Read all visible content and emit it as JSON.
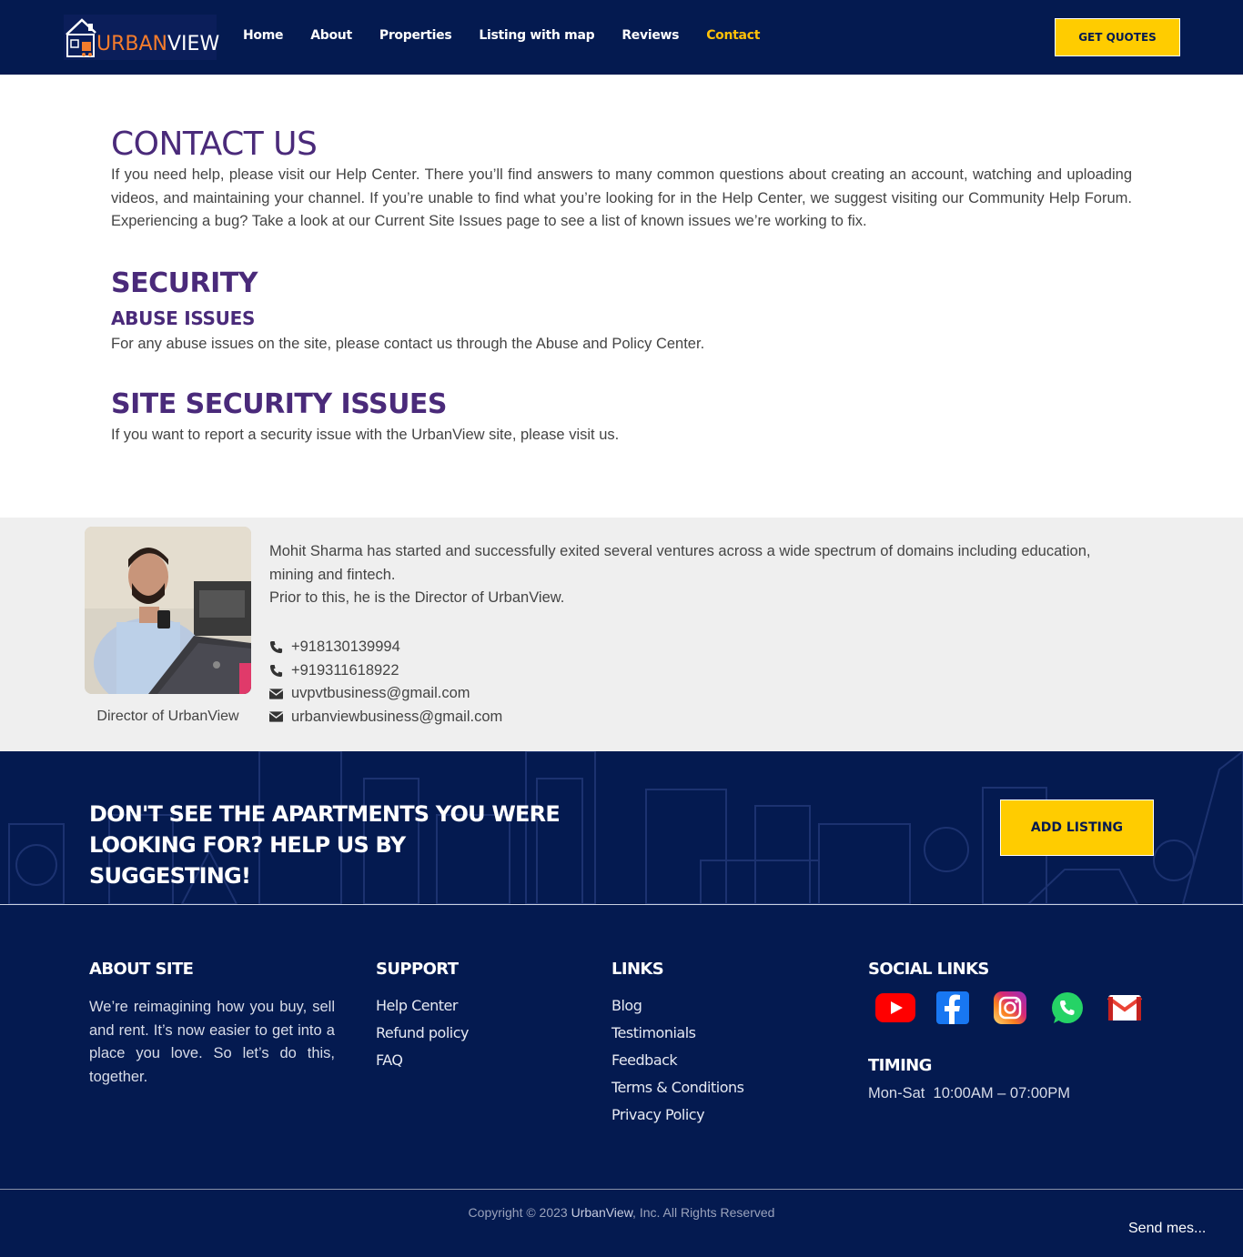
{
  "header": {
    "logo": {
      "text_urban": "URBAN",
      "text_view": "VIEW"
    },
    "nav": [
      {
        "label": "Home"
      },
      {
        "label": "About"
      },
      {
        "label": "Properties"
      },
      {
        "label": "Listing with map"
      },
      {
        "label": "Reviews"
      },
      {
        "label": "Contact",
        "active": true
      }
    ],
    "cta_label": "GET QUOTES"
  },
  "main": {
    "contact_title": "CONTACT US",
    "contact_text": "If you need help, please visit our Help Center. There you’ll find answers to many common questions about creating an account, watching and uploading videos, and maintaining your channel. If you’re unable to find what you’re looking for in the Help Center, we suggest visiting our Community Help Forum. Experiencing a bug? Take a look at our Current Site Issues page to see a list of known issues we’re working to fix.",
    "security_title": "SECURITY",
    "abuse_title": "ABUSE ISSUES",
    "abuse_text": "For any abuse issues on the site, please contact us through the Abuse and Policy Center.",
    "site_security_title": "SITE SECURITY ISSUES",
    "site_security_text": "If you want to report a security issue with the UrbanView site, please visit us."
  },
  "director": {
    "caption": "Director of UrbanView",
    "bio_line1": "Mohit Sharma has started and successfully exited several ventures across a wide spectrum of domains including education, mining and fintech.",
    "bio_line2": "Prior to this, he is the Director of UrbanView.",
    "phones": [
      "+918130139994",
      "+919311618922"
    ],
    "emails": [
      "uvpvtbusiness@gmail.com",
      "urbanviewbusiness@gmail.com"
    ]
  },
  "cta": {
    "title": "DON'T SEE THE APARTMENTS YOU WERE LOOKING FOR? HELP US BY SUGGESTING!",
    "button": "ADD LISTING"
  },
  "footer": {
    "about_title": "ABOUT SITE",
    "about_text": "We’re reimagining how you buy, sell and rent. It’s now easier to get into a place you love. So let’s do this, together.",
    "support_title": "SUPPORT",
    "support_links": [
      "Help Center",
      "Refund policy",
      "FAQ"
    ],
    "links_title": "LINKS",
    "links": [
      "Blog",
      "Testimonials",
      "Feedback",
      "Terms & Conditions",
      "Privacy Policy"
    ],
    "social_title": "SOCIAL LINKS",
    "social": [
      {
        "icon": "youtube-icon",
        "color": "#ff0000"
      },
      {
        "icon": "facebook-icon",
        "color": "#1877f2"
      },
      {
        "icon": "instagram-icon",
        "color": "#e1306c"
      },
      {
        "icon": "whatsapp-icon",
        "color": "#25d366"
      },
      {
        "icon": "gmail-icon",
        "color": "#ea4335"
      }
    ],
    "timing_title": "TIMING",
    "timing_text": "Mon-Sat  10:00AM – 07:00PM",
    "copyright_prefix": "Copyright © 2023 ",
    "copyright_brand": "UrbanView",
    "copyright_suffix": ", Inc. All Rights Reserved",
    "send_message": "Send mes..."
  },
  "colors": {
    "navy": "#041a50",
    "accent_yellow": "#ffcc00",
    "heading_purple": "#4a2a7a",
    "active_nav": "#ffc107"
  }
}
